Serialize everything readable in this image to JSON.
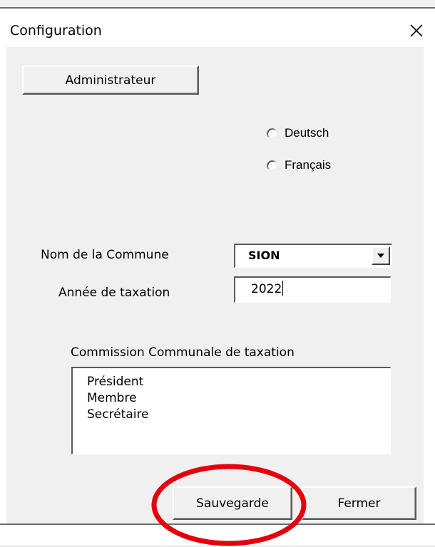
{
  "window": {
    "title": "Configuration",
    "close_icon": "close-icon"
  },
  "buttons": {
    "admin_label": "Administrateur",
    "save_label": "Sauvegarde",
    "close_label": "Fermer"
  },
  "language": {
    "options": [
      "Deutsch",
      "Français"
    ],
    "selected": null
  },
  "commune": {
    "label": "Nom de la Commune",
    "value": "SION",
    "dropdown_icon": "chevron-down-icon"
  },
  "annee": {
    "label": "Année de taxation",
    "value": "2022"
  },
  "commission": {
    "label": "Commission Communale de taxation",
    "items": [
      "Président",
      "Membre",
      "Secrétaire"
    ]
  },
  "colors": {
    "background": "#f0f0f0",
    "annotation_circle": "#e3000f"
  }
}
